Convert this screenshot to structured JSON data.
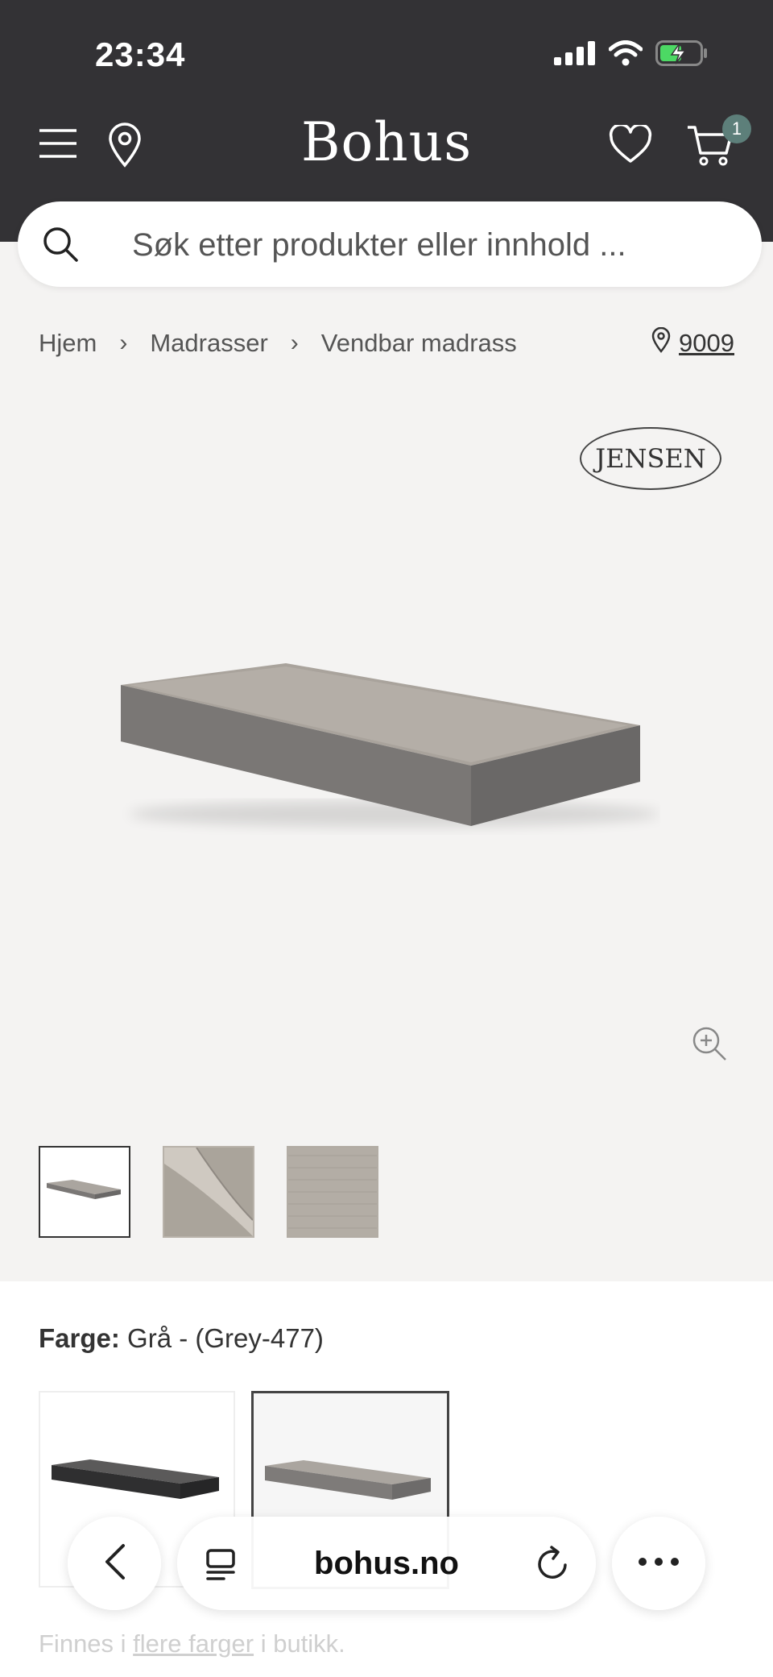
{
  "status_bar": {
    "time": "23:34"
  },
  "header": {
    "logo": "Bohus",
    "cart_count": "1"
  },
  "search": {
    "placeholder": "Søk etter produkter eller innhold ..."
  },
  "breadcrumb": {
    "items": [
      "Hjem",
      "Madrasser",
      "Vendbar madrass"
    ]
  },
  "store": {
    "number": "9009"
  },
  "product": {
    "brand": "JENSEN",
    "color_label": "Farge:",
    "color_value": "Grå - (Grey-477)"
  },
  "browser": {
    "url": "bohus.no"
  },
  "footer_note": {
    "prefix": "Finnes i",
    "link": "flere farger",
    "suffix": "i butikk."
  },
  "colors": {
    "header_bg": "#333235",
    "gallery_bg": "#f4f3f2",
    "badge": "#5d7f7a"
  }
}
